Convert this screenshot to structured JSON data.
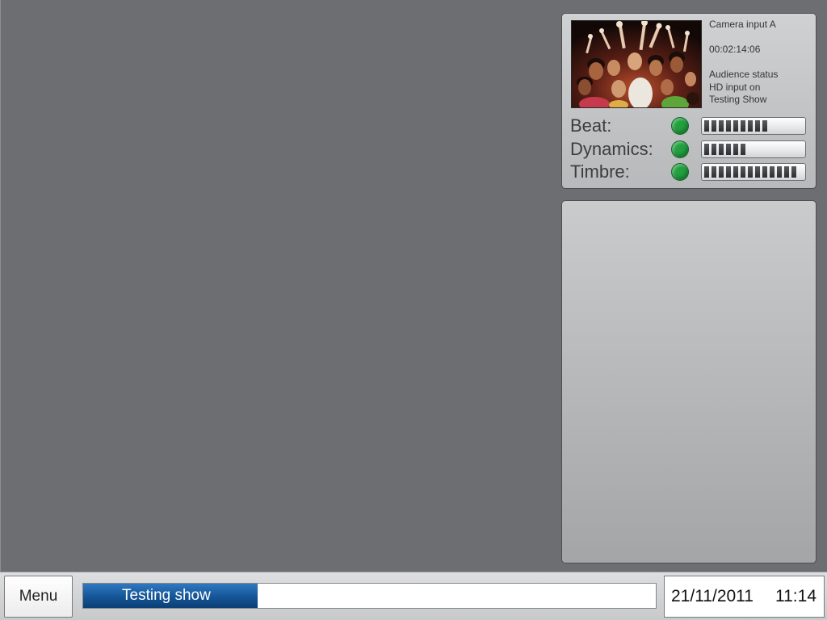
{
  "camera": {
    "input": "Camera input A",
    "timecode": "00:02:14:06",
    "status_lines": [
      "Audience status",
      "HD input on",
      "Testing Show"
    ]
  },
  "meters": {
    "items": [
      {
        "label": "Beat:",
        "indicator_color": "#22a03e",
        "level_segments": 9
      },
      {
        "label": "Dynamics:",
        "indicator_color": "#22a03e",
        "level_segments": 6
      },
      {
        "label": "Timbre:",
        "indicator_color": "#22a03e",
        "level_segments": 13
      }
    ]
  },
  "bottom_bar": {
    "menu_label": "Menu",
    "progress": {
      "label": "Testing show",
      "fraction": 0.305
    },
    "date": "21/11/2011",
    "time": "11:14"
  },
  "colors": {
    "background": "#6d6e71",
    "progress_fill": "#155597",
    "indicator_on": "#22a03e"
  }
}
